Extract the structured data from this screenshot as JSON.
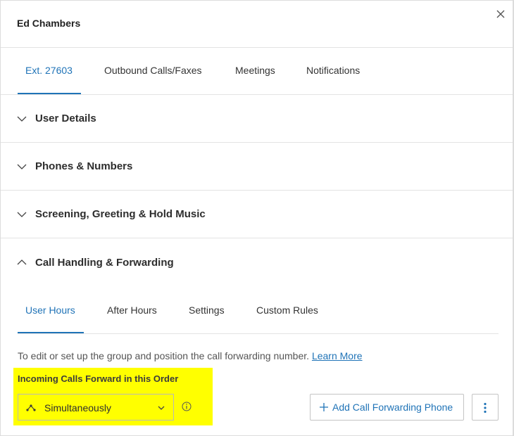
{
  "header": {
    "title": "Ed Chambers",
    "close_icon": "close-icon"
  },
  "tabs": [
    {
      "label": "Ext. 27603",
      "active": true
    },
    {
      "label": "Outbound Calls/Faxes",
      "active": false
    },
    {
      "label": "Meetings",
      "active": false
    },
    {
      "label": "Notifications",
      "active": false
    }
  ],
  "sections": [
    {
      "label": "User Details",
      "expanded": false
    },
    {
      "label": "Phones & Numbers",
      "expanded": false
    },
    {
      "label": "Screening, Greeting & Hold Music",
      "expanded": false
    },
    {
      "label": "Call Handling & Forwarding",
      "expanded": true
    }
  ],
  "subtabs": [
    {
      "label": "User Hours",
      "active": true
    },
    {
      "label": "After Hours",
      "active": false
    },
    {
      "label": "Settings",
      "active": false
    },
    {
      "label": "Custom Rules",
      "active": false
    }
  ],
  "forwarding": {
    "description": "To edit or set up the group and position the call forwarding number.",
    "learn_more": "Learn More",
    "order_label": "Incoming Calls Forward in this Order",
    "order_value": "Simultaneously",
    "add_button": "Add Call Forwarding Phone"
  },
  "colors": {
    "accent": "#1f73b7",
    "highlight": "#ffff00",
    "order_text": "#3b3b3b"
  }
}
